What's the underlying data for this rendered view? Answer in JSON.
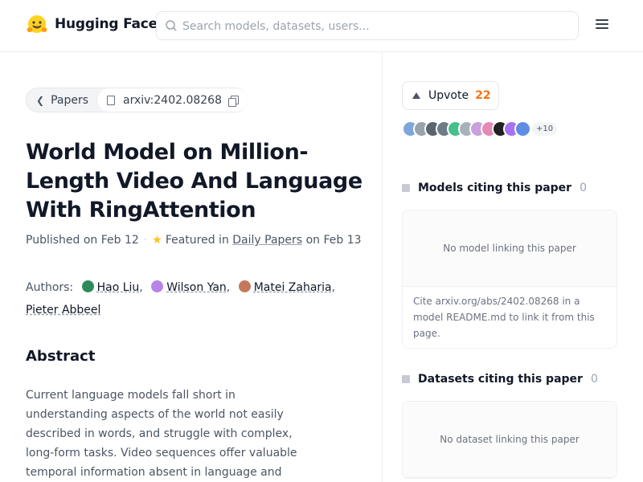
{
  "header": {
    "brand": "Hugging Face",
    "search_placeholder": "Search models, datasets, users..."
  },
  "breadcrumb": {
    "back_label": "Papers",
    "paper_id": "arxiv:2402.08268"
  },
  "paper": {
    "title": "World Model on Million-Length Video And Language With RingAttention",
    "published": "Published on Feb 12",
    "featured_prefix": "Featured in",
    "featured_link": "Daily Papers",
    "featured_suffix": "on Feb 13",
    "authors_label": "Authors:",
    "authors": [
      {
        "name": "Hao Liu",
        "sep": ",",
        "avatar_color": "#2e8b57"
      },
      {
        "name": "Wilson Yan",
        "sep": ",",
        "avatar_color": "#b783e8"
      },
      {
        "name": "Matei Zaharia",
        "sep": ",",
        "avatar_color": "#c47a5a"
      },
      {
        "name": "Pieter Abbeel",
        "sep": "",
        "avatar_color": ""
      }
    ],
    "abstract_title": "Abstract",
    "abstract_text": "Current language models fall short in understanding aspects of the world not easily described in words, and struggle with complex, long-form tasks. Video sequences offer valuable temporal information absent in language and static images, making them"
  },
  "sidebar": {
    "upvote_label": "Upvote",
    "upvote_count": "22",
    "voter_colors": [
      "#7da7d9",
      "#9aa3ad",
      "#5b6570",
      "#6f7b86",
      "#46c08c",
      "#a8b0b8",
      "#c9a0dc",
      "#e58ab5",
      "#222222",
      "#a872f0",
      "#5e8de6"
    ],
    "voters_more": "+10",
    "models_title": "Models citing this paper",
    "models_count": "0",
    "models_empty": "No model linking this paper",
    "models_hint": "Cite arxiv.org/abs/2402.08268 in a model README.md to link it from this page.",
    "datasets_title": "Datasets citing this paper",
    "datasets_count": "0",
    "datasets_empty": "No dataset linking this paper"
  },
  "colors": {
    "accent_upvote": "#f97316",
    "star": "#f5c518"
  }
}
